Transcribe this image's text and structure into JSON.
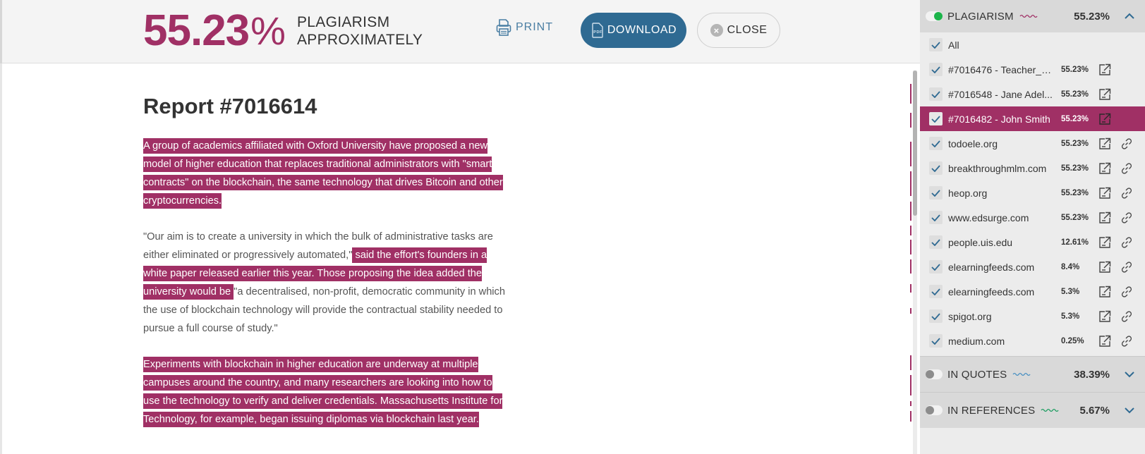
{
  "header": {
    "score_number": "55.23",
    "score_symbol": "%",
    "score_label_line1": "PLAGIARISM",
    "score_label_line2": "APPROXIMATELY",
    "print_label": "PRINT",
    "download_label": "DOWNLOAD",
    "close_label": "CLOSE",
    "icons": {
      "print": "printer-icon",
      "download": "pdf-file-icon",
      "close": "close-circle-icon"
    }
  },
  "document": {
    "title": "Report #7016614",
    "paragraphs": [
      [
        {
          "text": "A group of academics affiliated with Oxford University have proposed a new model of higher education that replaces traditional administrators with \"smart contracts\" on the blockchain, the same technology that drives Bitcoin and other cryptocurrencies.",
          "highlighted": true
        }
      ],
      [
        {
          "text": "\"Our aim is to create a university in which the bulk of administrative tasks are either eliminated or progressively automated,\"",
          "highlighted": false
        },
        {
          "text": " said the effort's founders in a white paper released earlier this year. Those proposing the idea added the university would be ",
          "highlighted": true
        },
        {
          "text": "\"a decentralised, non-profit, democratic community in which the use of blockchain technology will provide the contractual stability needed to pursue a full course of study.\"",
          "highlighted": false
        }
      ],
      [
        {
          "text": "Experiments with blockchain in higher education are underway at multiple campuses around the country, and many researchers are looking into how to use the technology to verify and deliver credentials. Massachusetts Institute for Technology, for example, began issuing diplomas via blockchain last year.",
          "highlighted": true
        }
      ]
    ]
  },
  "colors": {
    "accent": "#a03065",
    "download_button": "#2f6a92",
    "toggle_on": "#1cb44a",
    "quotes_squiggle": "#4a90c2",
    "references_squiggle": "#1e9e62"
  },
  "sidebar": {
    "plagiarism": {
      "label": "PLAGIARISM",
      "percent": "55.23%",
      "enabled": true,
      "expanded": true,
      "sources": [
        {
          "label": "All",
          "percent": "",
          "checked": true,
          "open": false,
          "link": false,
          "active": false
        },
        {
          "label": "#7016476 - Teacher_G...",
          "percent": "55.23%",
          "checked": true,
          "open": true,
          "link": false,
          "active": false
        },
        {
          "label": "#7016548 - Jane Adel...",
          "percent": "55.23%",
          "checked": true,
          "open": true,
          "link": false,
          "active": false
        },
        {
          "label": "#7016482 - John Smith",
          "percent": "55.23%",
          "checked": true,
          "open": true,
          "link": false,
          "active": true
        },
        {
          "label": "todoele.org",
          "percent": "55.23%",
          "checked": true,
          "open": true,
          "link": true,
          "active": false
        },
        {
          "label": "breakthroughmlm.com",
          "percent": "55.23%",
          "checked": true,
          "open": true,
          "link": true,
          "active": false
        },
        {
          "label": "heop.org",
          "percent": "55.23%",
          "checked": true,
          "open": true,
          "link": true,
          "active": false
        },
        {
          "label": "www.edsurge.com",
          "percent": "55.23%",
          "checked": true,
          "open": true,
          "link": true,
          "active": false
        },
        {
          "label": "people.uis.edu",
          "percent": "12.61%",
          "checked": true,
          "open": true,
          "link": true,
          "active": false
        },
        {
          "label": "elearningfeeds.com",
          "percent": "8.4%",
          "checked": true,
          "open": true,
          "link": true,
          "active": false
        },
        {
          "label": "elearningfeeds.com",
          "percent": "5.3%",
          "checked": true,
          "open": true,
          "link": true,
          "active": false
        },
        {
          "label": "spigot.org",
          "percent": "5.3%",
          "checked": true,
          "open": true,
          "link": true,
          "active": false
        },
        {
          "label": "medium.com",
          "percent": "0.25%",
          "checked": true,
          "open": true,
          "link": true,
          "active": false
        }
      ]
    },
    "quotes": {
      "label": "IN QUOTES",
      "percent": "38.39%",
      "enabled": false,
      "expanded": false
    },
    "references": {
      "label": "IN REFERENCES",
      "percent": "5.67%",
      "enabled": false,
      "expanded": false
    }
  }
}
